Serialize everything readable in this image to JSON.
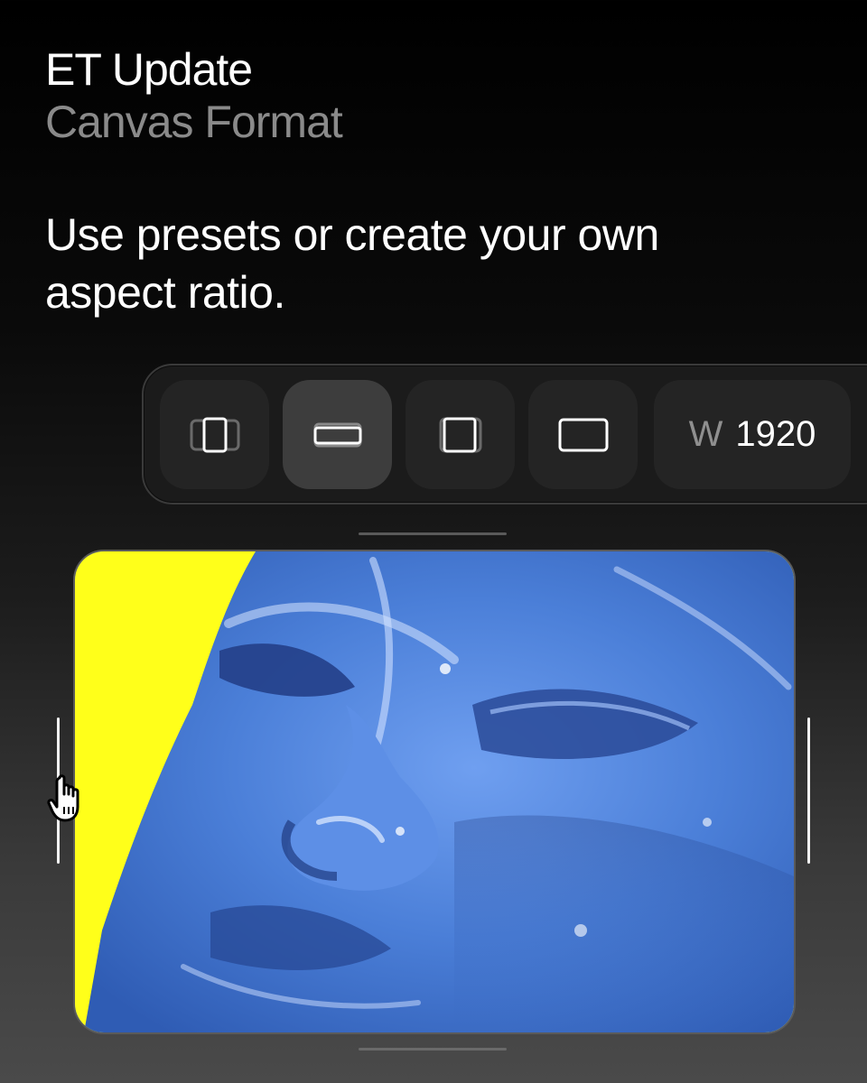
{
  "header": {
    "title": "ET Update",
    "subtitle": "Canvas Format"
  },
  "tagline": "Use presets or create your own aspect ratio.",
  "toolbar": {
    "presets": [
      {
        "icon": "portrait-ratio-icon",
        "active": false
      },
      {
        "icon": "landscape-wide-ratio-icon",
        "active": true
      },
      {
        "icon": "square-ratio-icon",
        "active": false
      },
      {
        "icon": "landscape-ratio-icon",
        "active": false
      }
    ],
    "width_label": "W",
    "width_value": "1920"
  },
  "canvas": {
    "colors": {
      "background": "#ffff1a",
      "face": "#4b7fd8",
      "face_shadow": "#27428a",
      "face_highlight": "#cfe0ff"
    }
  },
  "cursor": {
    "icon": "hand-pointer-icon"
  }
}
